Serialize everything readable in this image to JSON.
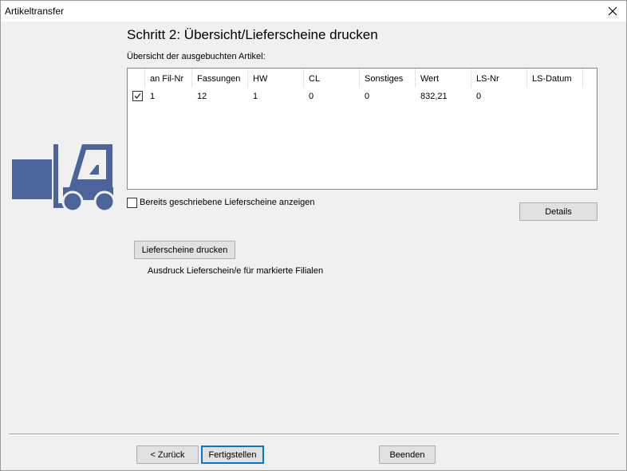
{
  "window": {
    "title": "Artikeltransfer"
  },
  "step": {
    "title": "Schritt 2: Übersicht/Lieferscheine drucken"
  },
  "overview": {
    "label": "Übersicht der ausgebuchten Artikel:"
  },
  "table": {
    "columns": [
      "",
      "an Fil-Nr",
      "Fassungen",
      "HW",
      "CL",
      "Sonstiges",
      "Wert",
      "LS-Nr",
      "LS-Datum"
    ],
    "rows": [
      {
        "checked": true,
        "an_fil_nr": "1",
        "fassungen": "12",
        "hw": "1",
        "cl": "0",
        "sonstiges": "0",
        "wert": "832,21",
        "ls_nr": "0",
        "ls_datum": ""
      }
    ]
  },
  "show_written": {
    "label": "Bereits geschriebene Lieferscheine anzeigen",
    "checked": false
  },
  "buttons": {
    "details": "Details",
    "print": "Lieferscheine drucken",
    "back": "< Zurück",
    "finish": "Fertigstellen",
    "quit": "Beenden"
  },
  "print_hint": "Ausdruck Lieferschein/e für markierte Filialen",
  "icons": {
    "close": "close-icon",
    "forklift": "forklift-icon",
    "check": "checkmark-icon"
  },
  "colors": {
    "forklift": "#4b6499",
    "focus": "#0078d7"
  }
}
